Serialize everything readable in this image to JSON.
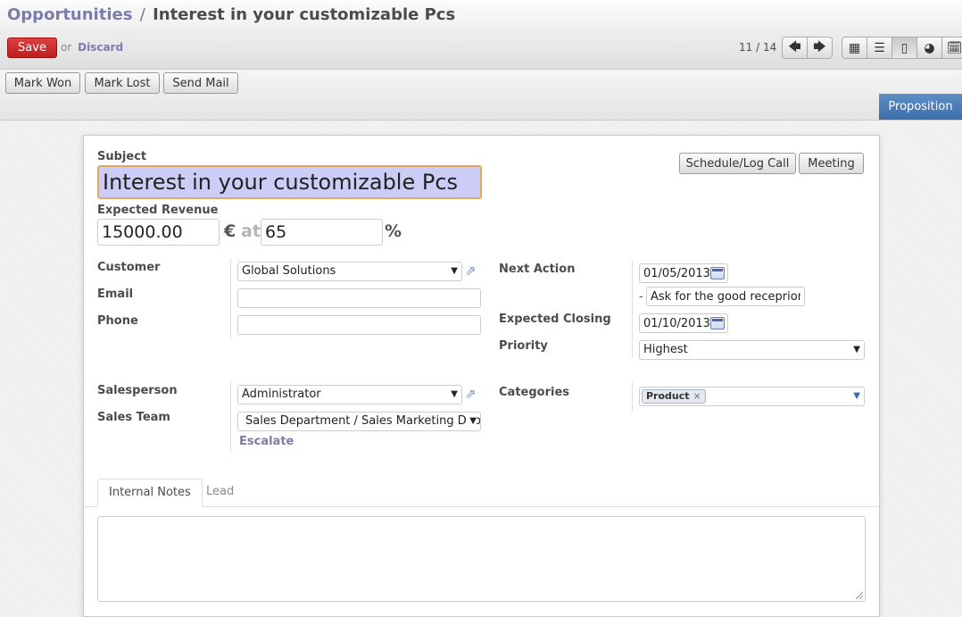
{
  "breadcrumb": {
    "parent": "Opportunities",
    "separator": "/",
    "current": "Interest in your customizable Pcs"
  },
  "toolbar": {
    "save_label": "Save",
    "or_label": "or",
    "discard_label": "Discard",
    "pager": "11 / 14"
  },
  "pager_buttons": [
    {
      "icon": "arrow-left-icon",
      "glyph": "🡄"
    },
    {
      "icon": "arrow-right-icon",
      "glyph": "🡆"
    }
  ],
  "view_switcher": [
    {
      "icon": "kanban-view-icon",
      "glyph": "▦",
      "active": false
    },
    {
      "icon": "list-view-icon",
      "glyph": "☰",
      "active": false
    },
    {
      "icon": "form-view-icon",
      "glyph": "▯",
      "active": true
    },
    {
      "icon": "graph-view-icon",
      "glyph": "◕",
      "active": false
    },
    {
      "icon": "calendar-view-icon",
      "glyph": "🗓",
      "active": false
    }
  ],
  "statusbar": {
    "buttons": [
      "Mark Won",
      "Mark Lost",
      "Send Mail"
    ],
    "stage": "Proposition"
  },
  "form": {
    "subject_label": "Subject",
    "subject_value": "Interest in your customizable Pcs",
    "actions": [
      "Schedule/Log Call",
      "Meeting"
    ],
    "expected_revenue_label": "Expected Revenue",
    "expected_revenue": "15000.00",
    "currency": "€",
    "at_label": "at",
    "probability": "65",
    "percent": "%",
    "customer_label": "Customer",
    "customer_value": "Global Solutions",
    "email_label": "Email",
    "email_value": "",
    "phone_label": "Phone",
    "phone_value": "",
    "next_action_label": "Next Action",
    "next_action_date": "01/05/2013",
    "next_action_dash": "-",
    "next_action_text": "Ask for the good receprion of",
    "expected_closing_label": "Expected Closing",
    "expected_closing_date": "01/10/2013",
    "priority_label": "Priority",
    "priority_value": "Highest",
    "salesperson_label": "Salesperson",
    "salesperson_value": "Administrator",
    "sales_team_label": "Sales Team",
    "sales_team_value": "Sales Department / Sales Marketing Department",
    "escalate_label": "Escalate",
    "categories_label": "Categories",
    "category_tag": "Product",
    "tag_remove": "×"
  },
  "tabs": [
    {
      "label": "Internal Notes",
      "active": true
    },
    {
      "label": "Lead",
      "active": false
    }
  ],
  "notes_value": ""
}
